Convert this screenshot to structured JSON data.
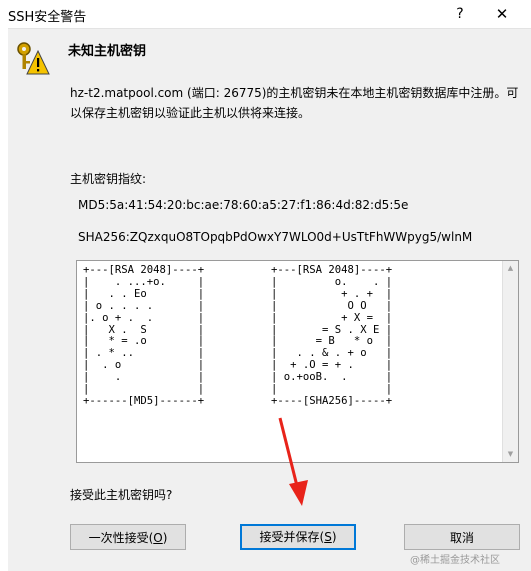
{
  "window": {
    "title": "SSH安全警告",
    "help_symbol": "?",
    "close_symbol": "✕"
  },
  "icon": {
    "name": "security-warning-icon",
    "accent": "#f5c300"
  },
  "heading": "未知主机密钥",
  "message": "hz-t2.matpool.com (端口: 26775)的主机密钥未在本地主机密钥数据库中注册。可以保存主机密钥以验证此主机以供将来连接。",
  "fingerprint": {
    "label": "主机密钥指纹:",
    "md5": "MD5:5a:41:54:20:bc:ae:78:60:a5:27:f1:86:4d:82:d5:5e",
    "sha256": "SHA256:ZQzxquO8TOpqbPdOwxY7WLO0d+UsTtFhWWpyg5/wlnM"
  },
  "randomart": {
    "md5": "+---[RSA 2048]----+\n|    . ...+o.     |\n|   . . Eo        |\n| o . . . .       |\n|. o + .  .       |\n|   X .  S        |\n|   * = .o        |\n| . * ..          |\n|  . o            |\n|    .            |\n|                 |\n+------[MD5]------+",
    "sha256": "+---[RSA 2048]----+\n|         o.    . |\n|          + . +  |\n|           O O   |\n|          + X =  |\n|       = S . X E |\n|      = B   * o  |\n|   . . & . + o   |\n|  + .O = + .     |\n| o.+ooB.  .      |\n|                 |\n+----[SHA256]-----+"
  },
  "question": "接受此主机密钥吗?",
  "buttons": {
    "accept_once": {
      "label": "一次性接受(",
      "key": "O",
      "suffix": ")"
    },
    "accept_save": {
      "label": "接受并保存(",
      "key": "S",
      "suffix": ")"
    },
    "cancel": {
      "label": "取消"
    }
  },
  "watermark": "@稀土掘金技术社区",
  "colors": {
    "focus_border": "#0078d7",
    "annotation_arrow": "#e8231a"
  }
}
